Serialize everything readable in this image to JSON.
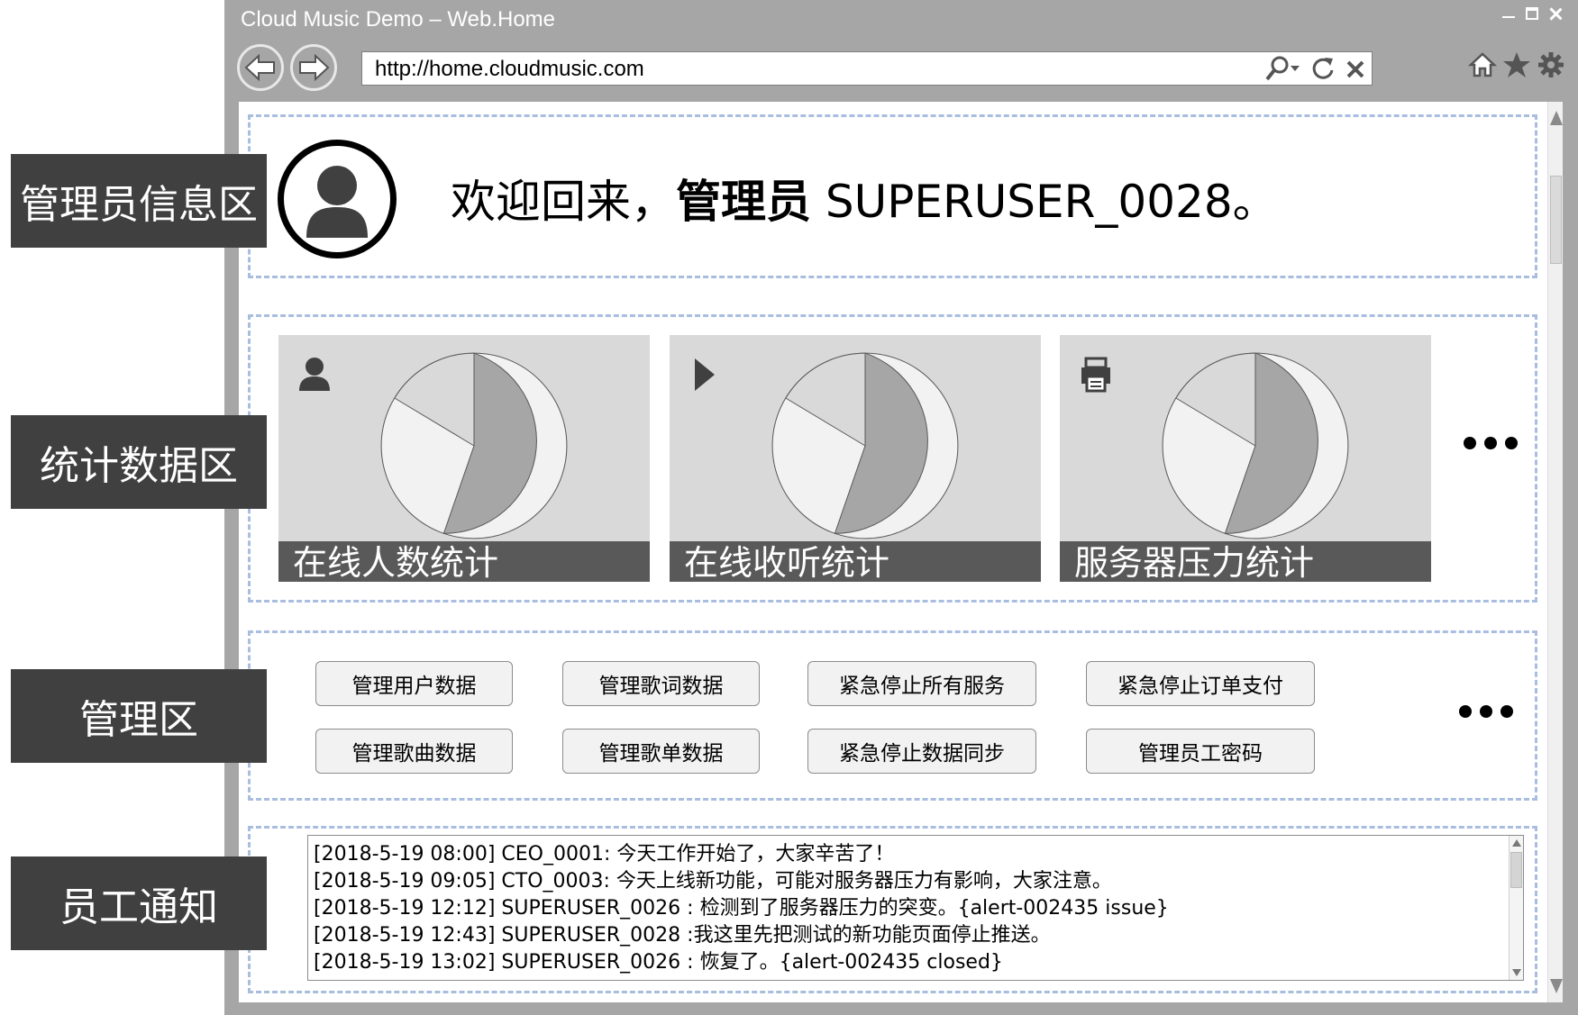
{
  "window": {
    "title": "Cloud Music Demo – Web.Home"
  },
  "address_bar": {
    "url": "http://home.cloudmusic.com"
  },
  "info": {
    "welcome_prefix": "欢迎回来，",
    "welcome_bold": "管理员",
    "welcome_user": " SUPERUSER_0028。"
  },
  "stats": {
    "cards": [
      {
        "icon": "user-icon",
        "caption": "在线人数统计"
      },
      {
        "icon": "play-icon",
        "caption": "在线收听统计"
      },
      {
        "icon": "printer-icon",
        "caption": "服务器压力统计"
      }
    ]
  },
  "admin": {
    "buttons": [
      {
        "label": "管理用户数据"
      },
      {
        "label": "管理歌词数据"
      },
      {
        "label": "紧急停止所有服务"
      },
      {
        "label": "紧急停止订单支付"
      },
      {
        "label": "管理歌曲数据"
      },
      {
        "label": "管理歌单数据"
      },
      {
        "label": "紧急停止数据同步"
      },
      {
        "label": "管理员工密码"
      }
    ]
  },
  "notices": {
    "lines": [
      "[2018-5-19 08:00] CEO_0001: 今天工作开始了，大家辛苦了！",
      "[2018-5-19 09:05] CTO_0003: 今天上线新功能，可能对服务器压力有影响，大家注意。",
      "[2018-5-19 12:12] SUPERUSER_0026 : 检测到了服务器压力的突变。{alert-002435 issue}",
      "[2018-5-19 12:43] SUPERUSER_0028 :我这里先把测试的新功能页面停止推送。",
      "[2018-5-19 13:02] SUPERUSER_0026 : 恢复了。{alert-002435 closed}"
    ]
  },
  "side_labels": {
    "info": "管理员信息区",
    "stats": "统计数据区",
    "admin": "管理区",
    "notice": "员工通知"
  },
  "colors": {
    "chrome": "#a6a6a6",
    "dashed_border": "#a9bde0",
    "card_bg": "#d9d9d9",
    "caption_bg": "#595959",
    "label_bg": "#404040"
  }
}
